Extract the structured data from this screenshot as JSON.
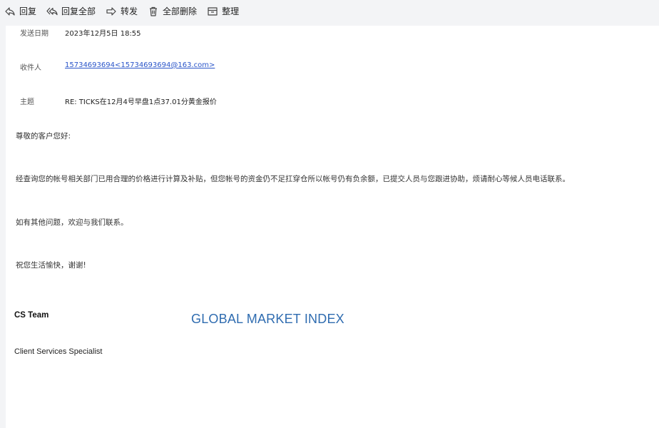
{
  "toolbar": {
    "reply": "回复",
    "reply_all": "回复全部",
    "forward": "转发",
    "delete_all": "全部删除",
    "organize": "整理"
  },
  "meta": {
    "date_label": "发送日期",
    "date_value": "2023年12月5日 18:55",
    "recipient_label": "收件人",
    "recipient_value": "15734693694<15734693694@163.com>",
    "subject_label": "主题",
    "subject_value": "RE: TICKS在12月4号早盘1点37.01分黄金报价"
  },
  "body": {
    "greeting": "尊敬的客户您好:",
    "p1": "经查询您的帐号相关部门已用合理的价格进行计算及补贴，但您帐号的资金仍不足扛穿仓所以帐号仍有负余额，已提交人员与您跟进协助，烦请耐心等候人员电话联系。",
    "p2": "如有其他问题，欢迎与我们联系。",
    "p3": "祝您生活愉快，谢谢!"
  },
  "signature": {
    "team": "CS Team",
    "brand": "GLOBAL MARKET INDEX",
    "role": "Client Services Specialist"
  },
  "icons": {
    "reply": "reply-icon",
    "reply_all": "reply-all-icon",
    "forward": "forward-icon",
    "delete_all": "trash-icon",
    "organize": "archive-icon"
  },
  "colors": {
    "link": "#2a55c9",
    "brand": "#2f6cb0",
    "toolbar_bg": "#f3f4f6"
  }
}
